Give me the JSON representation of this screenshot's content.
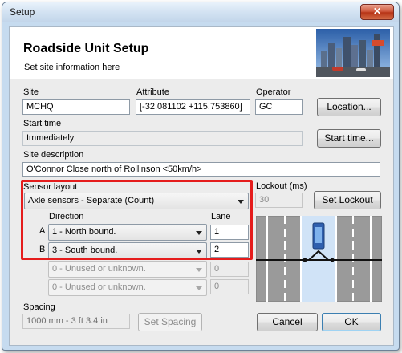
{
  "window": {
    "title": "Setup",
    "close_glyph": "✕"
  },
  "header": {
    "title": "Roadside Unit Setup",
    "subtitle": "Set site information here"
  },
  "site": {
    "label": "Site",
    "value": "MCHQ"
  },
  "attribute": {
    "label": "Attribute",
    "value": "[-32.081102 +115.753860]"
  },
  "operator": {
    "label": "Operator",
    "value": "GC"
  },
  "location_button": "Location...",
  "start_time": {
    "label": "Start time",
    "value": "Immediately",
    "button": "Start time..."
  },
  "site_description": {
    "label": "Site description",
    "value": "O'Connor Close north of Rollinson <50km/h>"
  },
  "sensor_layout": {
    "label": "Sensor layout",
    "selected": "Axle sensors - Separate (Count)"
  },
  "lockout": {
    "label": "Lockout (ms)",
    "value": "30",
    "button": "Set Lockout"
  },
  "sensors": {
    "direction_header": "Direction",
    "lane_header": "Lane",
    "rows": [
      {
        "letter": "A",
        "direction": "1 - North bound.",
        "lane": "1",
        "enabled": true
      },
      {
        "letter": "B",
        "direction": "3 - South bound.",
        "lane": "2",
        "enabled": true
      },
      {
        "letter": "",
        "direction": "0 - Unused or unknown.",
        "lane": "0",
        "enabled": false
      },
      {
        "letter": "",
        "direction": "0 - Unused or unknown.",
        "lane": "0",
        "enabled": false
      }
    ]
  },
  "spacing": {
    "label": "Spacing",
    "value": "1000 mm - 3 ft 3.4 in",
    "button": "Set Spacing"
  },
  "footer": {
    "cancel": "Cancel",
    "ok": "OK"
  },
  "diagram": {
    "device_label": "Roadside Unit"
  },
  "colors": {
    "highlight": "#e51c1c",
    "road": "#959595",
    "lane_marks": "#ffffff",
    "selected_lane": "#cfe2f7"
  }
}
